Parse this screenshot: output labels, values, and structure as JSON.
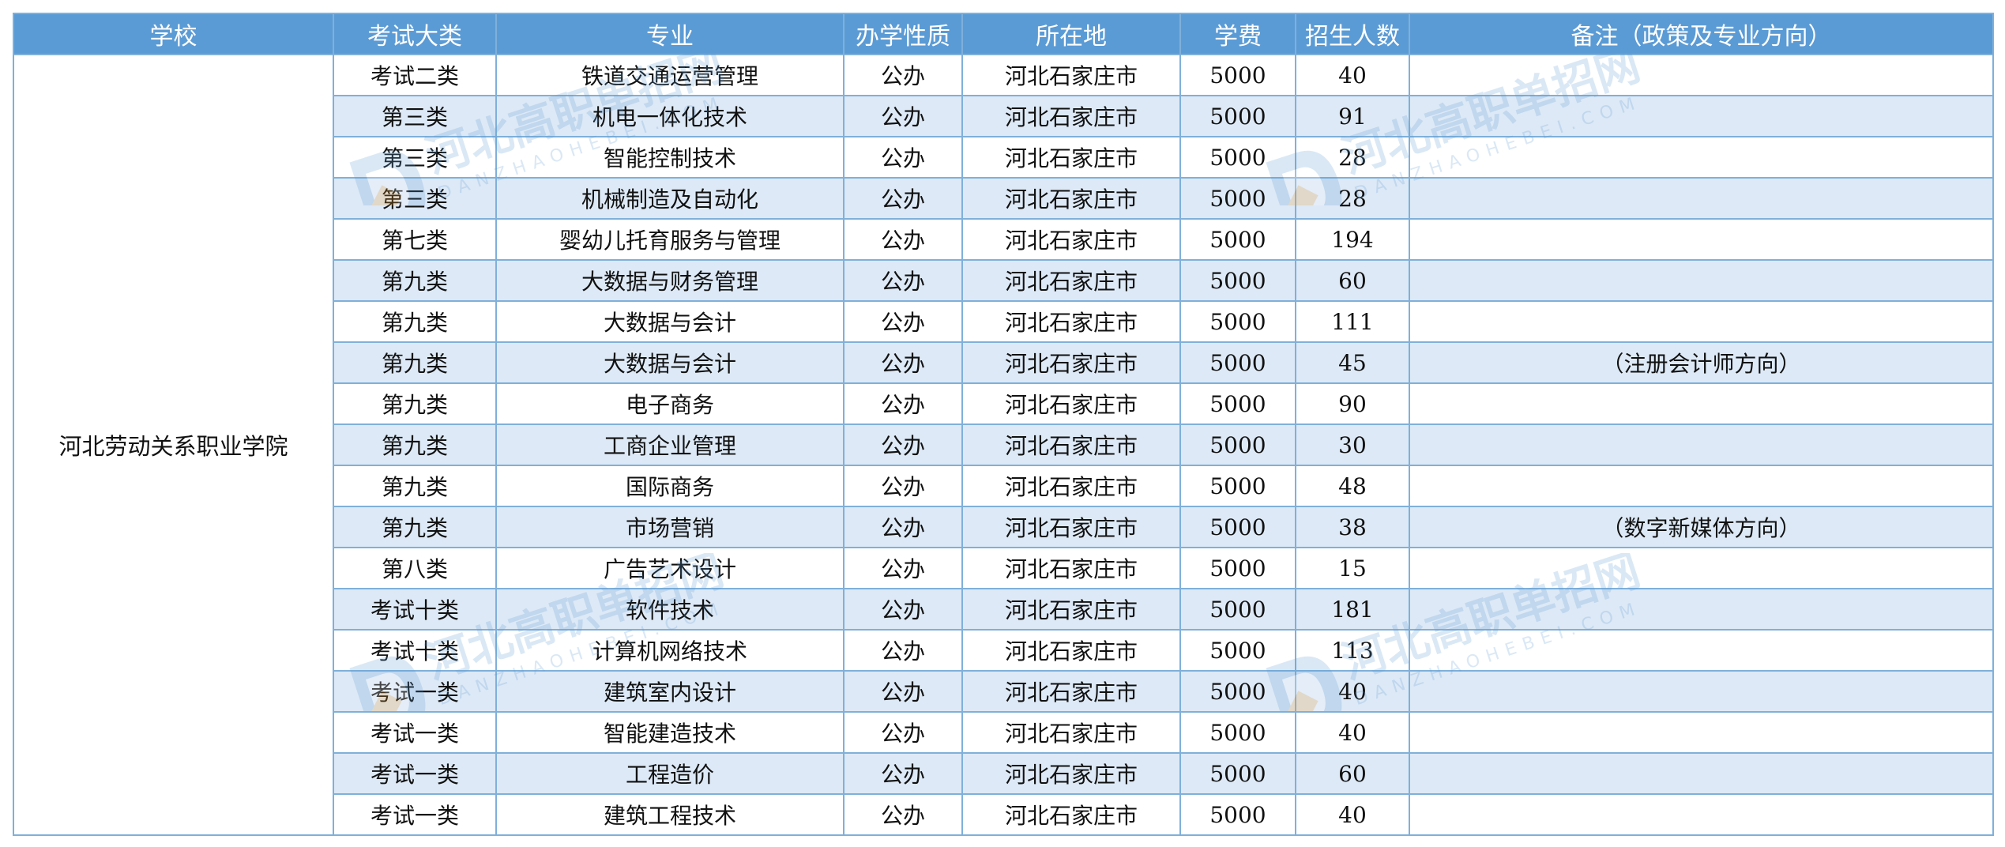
{
  "columns": [
    "学校",
    "考试大类",
    "专业",
    "办学性质",
    "所在地",
    "学费",
    "招生人数",
    "备注（政策及专业方向）"
  ],
  "school": "河北劳动关系职业学院",
  "rows": [
    {
      "category": "考试二类",
      "major": "铁道交通运营管理",
      "nature": "公办",
      "location": "河北石家庄市",
      "fee": "5000",
      "count": "40",
      "note": ""
    },
    {
      "category": "第三类",
      "major": "机电一体化技术",
      "nature": "公办",
      "location": "河北石家庄市",
      "fee": "5000",
      "count": "91",
      "note": ""
    },
    {
      "category": "第三类",
      "major": "智能控制技术",
      "nature": "公办",
      "location": "河北石家庄市",
      "fee": "5000",
      "count": "28",
      "note": ""
    },
    {
      "category": "第三类",
      "major": "机械制造及自动化",
      "nature": "公办",
      "location": "河北石家庄市",
      "fee": "5000",
      "count": "28",
      "note": ""
    },
    {
      "category": "第七类",
      "major": "婴幼儿托育服务与管理",
      "nature": "公办",
      "location": "河北石家庄市",
      "fee": "5000",
      "count": "194",
      "note": ""
    },
    {
      "category": "第九类",
      "major": "大数据与财务管理",
      "nature": "公办",
      "location": "河北石家庄市",
      "fee": "5000",
      "count": "60",
      "note": ""
    },
    {
      "category": "第九类",
      "major": "大数据与会计",
      "nature": "公办",
      "location": "河北石家庄市",
      "fee": "5000",
      "count": "111",
      "note": ""
    },
    {
      "category": "第九类",
      "major": "大数据与会计",
      "nature": "公办",
      "location": "河北石家庄市",
      "fee": "5000",
      "count": "45",
      "note": "（注册会计师方向）"
    },
    {
      "category": "第九类",
      "major": "电子商务",
      "nature": "公办",
      "location": "河北石家庄市",
      "fee": "5000",
      "count": "90",
      "note": ""
    },
    {
      "category": "第九类",
      "major": "工商企业管理",
      "nature": "公办",
      "location": "河北石家庄市",
      "fee": "5000",
      "count": "30",
      "note": ""
    },
    {
      "category": "第九类",
      "major": "国际商务",
      "nature": "公办",
      "location": "河北石家庄市",
      "fee": "5000",
      "count": "48",
      "note": ""
    },
    {
      "category": "第九类",
      "major": "市场营销",
      "nature": "公办",
      "location": "河北石家庄市",
      "fee": "5000",
      "count": "38",
      "note": "（数字新媒体方向）"
    },
    {
      "category": "第八类",
      "major": "广告艺术设计",
      "nature": "公办",
      "location": "河北石家庄市",
      "fee": "5000",
      "count": "15",
      "note": ""
    },
    {
      "category": "考试十类",
      "major": "软件技术",
      "nature": "公办",
      "location": "河北石家庄市",
      "fee": "5000",
      "count": "181",
      "note": ""
    },
    {
      "category": "考试十类",
      "major": "计算机网络技术",
      "nature": "公办",
      "location": "河北石家庄市",
      "fee": "5000",
      "count": "113",
      "note": ""
    },
    {
      "category": "考试一类",
      "major": "建筑室内设计",
      "nature": "公办",
      "location": "河北石家庄市",
      "fee": "5000",
      "count": "40",
      "note": ""
    },
    {
      "category": "考试一类",
      "major": "智能建造技术",
      "nature": "公办",
      "location": "河北石家庄市",
      "fee": "5000",
      "count": "40",
      "note": ""
    },
    {
      "category": "考试一类",
      "major": "工程造价",
      "nature": "公办",
      "location": "河北石家庄市",
      "fee": "5000",
      "count": "60",
      "note": ""
    },
    {
      "category": "考试一类",
      "major": "建筑工程技术",
      "nature": "公办",
      "location": "河北石家庄市",
      "fee": "5000",
      "count": "40",
      "note": ""
    }
  ],
  "watermark": {
    "title": "河北高职单招网",
    "domain": "DANZHAOHEBEI.COM",
    "color": "#5b9bd5",
    "accent": "#f0a030"
  },
  "colors": {
    "header_bg": "#5b9bd5",
    "stripe": "#dde9f6",
    "border": "#7fb0da"
  }
}
